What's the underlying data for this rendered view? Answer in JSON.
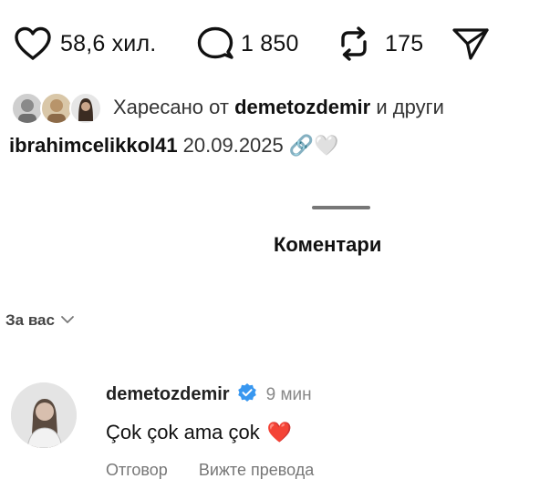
{
  "colors": {
    "text": "#111111",
    "muted": "#888888",
    "verified": "#3897f0",
    "heart_red": "#e8283c"
  },
  "actions": {
    "likes_count": "58,6 хил.",
    "comments_count": "1 850",
    "reposts_count": "175",
    "icons": [
      "heart-icon",
      "comment-bubble-icon",
      "repost-icon",
      "send-paper-plane-icon"
    ]
  },
  "liked_by": {
    "prefix": "Харесано от",
    "user": "demetozdemir",
    "suffix": "и други"
  },
  "caption": {
    "user": "ibrahimcelikkol41",
    "date": "20.09.2025",
    "emojis": "🔗🤍"
  },
  "comments_sheet": {
    "title": "Коментари",
    "filter_label": "За вас"
  },
  "comment": {
    "user": "demetozdemir",
    "time": "9 мин",
    "text": "Çok çok ama çok",
    "emoji": "❤️",
    "reply_label": "Отговор",
    "translate_label": "Вижте превода"
  }
}
